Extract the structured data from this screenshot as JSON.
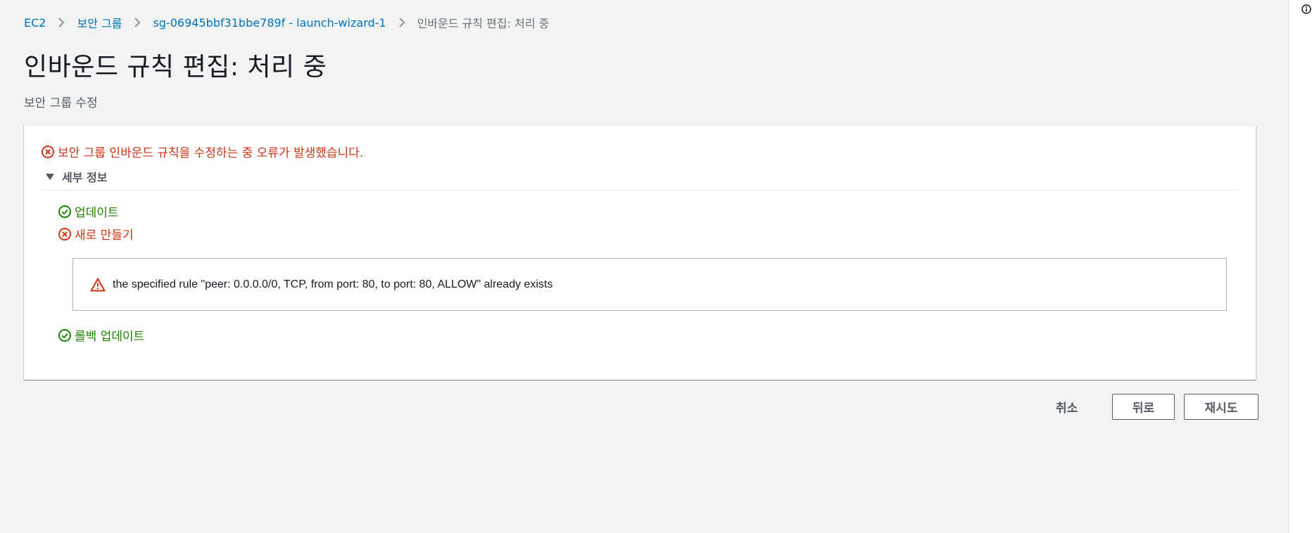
{
  "breadcrumb": {
    "items": [
      {
        "label": "EC2"
      },
      {
        "label": "보안 그룹"
      },
      {
        "label": "sg-06945bbf31bbe789f - launch-wizard-1"
      }
    ],
    "current": "인바운드 규칙 편집: 처리 중"
  },
  "page": {
    "title": "인바운드 규칙 편집: 처리 중",
    "subtitle": "보안 그룹 수정"
  },
  "panel": {
    "error_summary": "보안 그룹 인바운드 규칙을 수정하는 중 오류가 발생했습니다.",
    "details_label": "세부 정보",
    "steps": [
      {
        "label": "업데이트",
        "status": "success"
      },
      {
        "label": "새로 만들기",
        "status": "error"
      },
      {
        "label": "롤백 업데이트",
        "status": "success"
      }
    ],
    "error_detail": "the specified rule \"peer: 0.0.0.0/0, TCP, from port: 80, to port: 80, ALLOW\" already exists"
  },
  "actions": {
    "cancel_label": "취소",
    "back_label": "뒤로",
    "retry_label": "재시도"
  },
  "colors": {
    "link": "#0073bb",
    "error": "#d13212",
    "success": "#1d8102",
    "text_secondary": "#545b64",
    "background": "#f2f3f3"
  },
  "icons": {
    "error": "error-circle-icon",
    "success": "check-circle-icon",
    "warning": "warning-triangle-icon",
    "caret": "caret-down-icon",
    "chevron": "chevron-right-icon",
    "info": "info-icon"
  }
}
